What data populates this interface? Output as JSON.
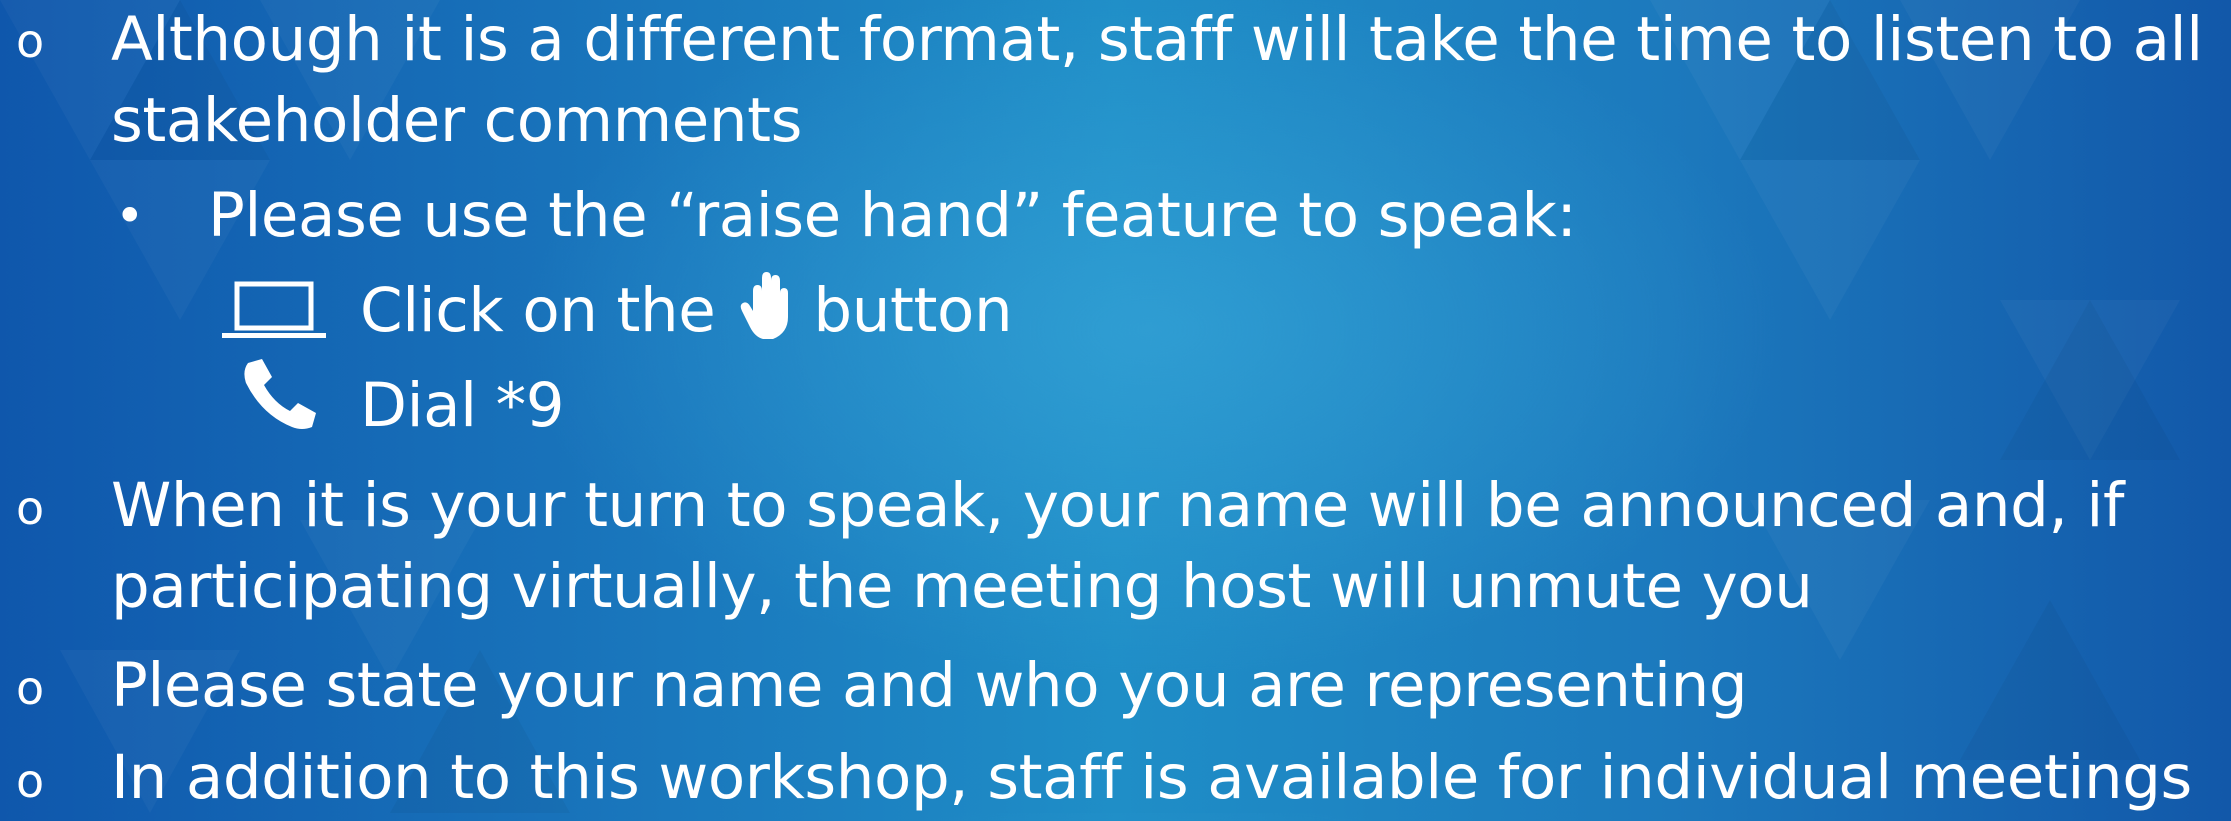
{
  "slide": {
    "bullets": [
      {
        "marker": "o",
        "lines": [
          "Although it is a different format, staff will take the time to listen to all",
          "stakeholder comments"
        ],
        "sub": {
          "marker": "•",
          "text": "Please use the “raise hand” feature to speak:",
          "items": [
            {
              "icon": "laptop-icon",
              "text_before": "Click on the",
              "inline_icon": "raised-hand-icon",
              "text_after": "button"
            },
            {
              "icon": "phone-icon",
              "text": "Dial *9"
            }
          ]
        }
      },
      {
        "marker": "o",
        "lines": [
          "When it is your turn to speak, your name will be announced and, if",
          "participating virtually, the meeting host will unmute you"
        ]
      },
      {
        "marker": "o",
        "lines": [
          "Please state your name and who you are representing"
        ]
      },
      {
        "marker": "o",
        "lines": [
          "In addition to this workshop, staff is available for individual meetings"
        ]
      }
    ]
  },
  "colors": {
    "text": "#ffffff",
    "bg_dark": "#0f57ac",
    "bg_light": "#1f8ec7"
  }
}
